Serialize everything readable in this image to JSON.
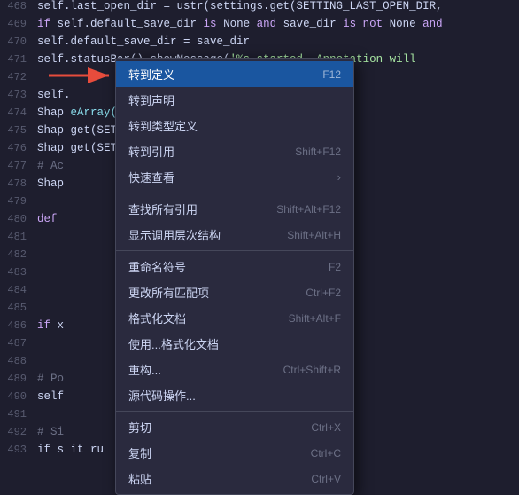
{
  "editor": {
    "background": "#1e1e2e",
    "lines": [
      {
        "number": "468",
        "tokens": [
          {
            "text": "        self.last_open_dir = ustr(settings.get(SETTING_LAST_OPEN_DIR,",
            "color": "#cdd6f4"
          }
        ]
      },
      {
        "number": "469",
        "tokens": [
          {
            "text": "        if self.default_save_dir is None and save_dir is not None and",
            "color": "#cdd6f4"
          }
        ]
      },
      {
        "number": "470",
        "tokens": [
          {
            "text": "            self.default_save_dir = save_dir",
            "color": "#cdd6f4"
          }
        ]
      },
      {
        "number": "471",
        "tokens": [
          {
            "text": "        self.statusBar().showMessage('%s started. Annotation will",
            "color": "#cdd6f4"
          }
        ]
      },
      {
        "number": "472",
        "tokens": []
      },
      {
        "number": "473",
        "tokens": [
          {
            "text": "        self.",
            "color": "#cdd6f4"
          }
        ]
      },
      {
        "number": "474",
        "tokens": [
          {
            "text": "        Shap",
            "color": "#cdd6f4"
          },
          {
            "text": "                                    eArray(",
            "color": "#cdd6f4"
          }
        ]
      },
      {
        "number": "475",
        "tokens": [
          {
            "text": "        Shap",
            "color": "#cdd6f4"
          },
          {
            "text": "                                    get(SETT",
            "color": "#cdd6f4"
          }
        ]
      },
      {
        "number": "476",
        "tokens": [
          {
            "text": "        Shap",
            "color": "#cdd6f4"
          },
          {
            "text": "                                    get(SETT",
            "color": "#cdd6f4"
          }
        ]
      },
      {
        "number": "477",
        "tokens": [
          {
            "text": "        # Ac",
            "color": "#6c7086"
          }
        ]
      },
      {
        "number": "478",
        "tokens": [
          {
            "text": "        Shap",
            "color": "#cdd6f4"
          }
        ]
      },
      {
        "number": "479",
        "tokens": []
      },
      {
        "number": "480",
        "tokens": [
          {
            "text": "        def",
            "color": "#cba6f7"
          }
        ]
      },
      {
        "number": "481",
        "tokens": []
      },
      {
        "number": "482",
        "tokens": []
      },
      {
        "number": "483",
        "tokens": []
      },
      {
        "number": "484",
        "tokens": []
      },
      {
        "number": "485",
        "tokens": []
      },
      {
        "number": "486",
        "tokens": [
          {
            "text": "        if x",
            "color": "#cdd6f4"
          }
        ]
      },
      {
        "number": "487",
        "tokens": []
      },
      {
        "number": "488",
        "tokens": []
      },
      {
        "number": "489",
        "tokens": [
          {
            "text": "        # Po",
            "color": "#6c7086"
          }
        ]
      },
      {
        "number": "490",
        "tokens": [
          {
            "text": "        self",
            "color": "#cdd6f4"
          }
        ]
      },
      {
        "number": "491",
        "tokens": []
      },
      {
        "number": "492",
        "tokens": [
          {
            "text": "        # Si",
            "color": "#6c7086"
          }
        ]
      },
      {
        "number": "493",
        "tokens": [
          {
            "text": "        if s",
            "color": "#cdd6f4"
          },
          {
            "text": "                    it ru",
            "color": "#cdd6f4"
          }
        ]
      }
    ]
  },
  "context_menu": {
    "items": [
      {
        "id": "goto-definition",
        "label": "转到定义",
        "shortcut": "F12",
        "active": true,
        "divider_after": false
      },
      {
        "id": "goto-declaration",
        "label": "转到声明",
        "shortcut": "",
        "active": false,
        "divider_after": false
      },
      {
        "id": "goto-type-definition",
        "label": "转到类型定义",
        "shortcut": "",
        "active": false,
        "divider_after": false
      },
      {
        "id": "goto-references",
        "label": "转到引用",
        "shortcut": "Shift+F12",
        "active": false,
        "divider_after": false
      },
      {
        "id": "peek",
        "label": "快速查看",
        "shortcut": "",
        "active": false,
        "has_arrow": true,
        "divider_after": true
      },
      {
        "id": "find-all-references",
        "label": "查找所有引用",
        "shortcut": "Shift+Alt+F12",
        "active": false,
        "divider_after": false
      },
      {
        "id": "show-call-hierarchy",
        "label": "显示调用层次结构",
        "shortcut": "Shift+Alt+H",
        "active": false,
        "divider_after": true
      },
      {
        "id": "rename-symbol",
        "label": "重命名符号",
        "shortcut": "F2",
        "active": false,
        "divider_after": false
      },
      {
        "id": "change-all-occurrences",
        "label": "更改所有匹配项",
        "shortcut": "Ctrl+F2",
        "active": false,
        "divider_after": false
      },
      {
        "id": "format-document",
        "label": "格式化文档",
        "shortcut": "Shift+Alt+F",
        "active": false,
        "divider_after": false
      },
      {
        "id": "format-with",
        "label": "使用...格式化文档",
        "shortcut": "",
        "active": false,
        "divider_after": false
      },
      {
        "id": "refactor",
        "label": "重构...",
        "shortcut": "Ctrl+Shift+R",
        "active": false,
        "divider_after": false
      },
      {
        "id": "source-action",
        "label": "源代码操作...",
        "shortcut": "",
        "active": false,
        "divider_after": true
      },
      {
        "id": "cut",
        "label": "剪切",
        "shortcut": "Ctrl+X",
        "active": false,
        "divider_after": false
      },
      {
        "id": "copy",
        "label": "复制",
        "shortcut": "Ctrl+C",
        "active": false,
        "divider_after": false
      },
      {
        "id": "paste",
        "label": "粘贴",
        "shortcut": "Ctrl+V",
        "active": false,
        "divider_after": false
      }
    ]
  }
}
